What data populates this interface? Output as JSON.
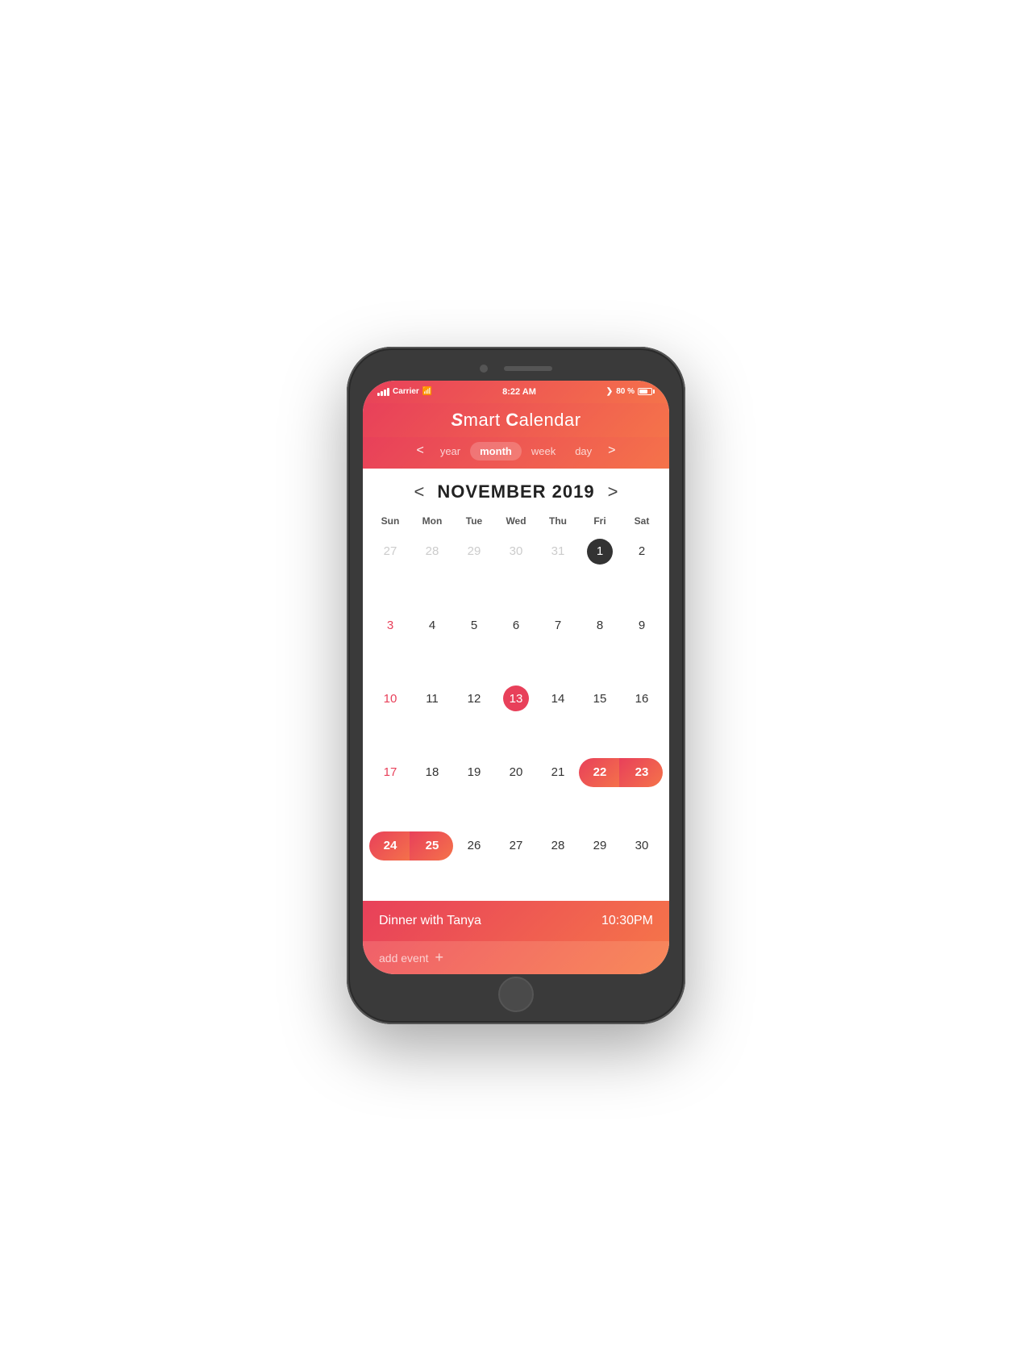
{
  "phone": {
    "status": {
      "carrier": "Carrier",
      "wifi_icon": "wifi",
      "time": "8:22 AM",
      "signal_icon": "signal",
      "battery_percent": "80 %"
    },
    "app": {
      "title_part1": "S",
      "title_part2": "mart ",
      "title_part3": "C",
      "title_part4": "alendar"
    },
    "tabs": {
      "prev_chevron": "<",
      "next_chevron": ">",
      "items": [
        {
          "label": "year",
          "active": false
        },
        {
          "label": "month",
          "active": true
        },
        {
          "label": "week",
          "active": false
        },
        {
          "label": "day",
          "active": false
        }
      ]
    },
    "calendar": {
      "prev_chevron": "<",
      "next_chevron": ">",
      "month_year": "NOVEMBER 2019",
      "day_headers": [
        "Sun",
        "Mon",
        "Tue",
        "Wed",
        "Thu",
        "Fri",
        "Sat"
      ],
      "weeks": [
        [
          {
            "num": "27",
            "type": "other-month"
          },
          {
            "num": "28",
            "type": "other-month"
          },
          {
            "num": "29",
            "type": "other-month"
          },
          {
            "num": "30",
            "type": "other-month"
          },
          {
            "num": "31",
            "type": "other-month"
          },
          {
            "num": "1",
            "type": "today"
          },
          {
            "num": "2",
            "type": "normal"
          }
        ],
        [
          {
            "num": "3",
            "type": "sunday"
          },
          {
            "num": "4",
            "type": "normal"
          },
          {
            "num": "5",
            "type": "normal"
          },
          {
            "num": "6",
            "type": "normal"
          },
          {
            "num": "7",
            "type": "normal"
          },
          {
            "num": "8",
            "type": "normal"
          },
          {
            "num": "9",
            "type": "normal"
          }
        ],
        [
          {
            "num": "10",
            "type": "sunday"
          },
          {
            "num": "11",
            "type": "normal"
          },
          {
            "num": "12",
            "type": "normal"
          },
          {
            "num": "13",
            "type": "selected"
          },
          {
            "num": "14",
            "type": "normal"
          },
          {
            "num": "15",
            "type": "normal"
          },
          {
            "num": "16",
            "type": "normal"
          }
        ],
        [
          {
            "num": "17",
            "type": "sunday"
          },
          {
            "num": "18",
            "type": "normal"
          },
          {
            "num": "19",
            "type": "normal"
          },
          {
            "num": "20",
            "type": "normal"
          },
          {
            "num": "21",
            "type": "normal"
          },
          {
            "num": "22",
            "type": "range-start"
          },
          {
            "num": "23",
            "type": "range-end-pill"
          }
        ],
        [
          {
            "num": "24",
            "type": "range-start-pill"
          },
          {
            "num": "25",
            "type": "range-end"
          },
          {
            "num": "26",
            "type": "normal"
          },
          {
            "num": "27",
            "type": "normal"
          },
          {
            "num": "28",
            "type": "normal"
          },
          {
            "num": "29",
            "type": "normal"
          },
          {
            "num": "30",
            "type": "normal"
          }
        ]
      ]
    },
    "events": [
      {
        "name": "Dinner with Tanya",
        "time": "10:30PM"
      }
    ],
    "add_event": {
      "label": "add event",
      "plus": "+"
    }
  }
}
